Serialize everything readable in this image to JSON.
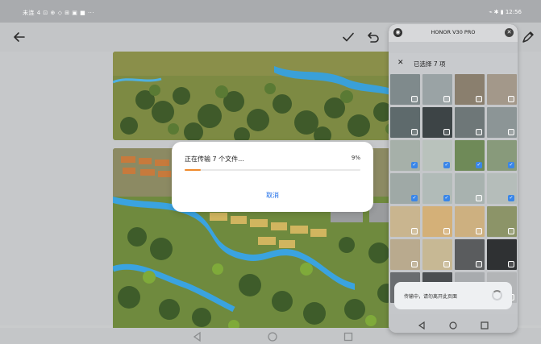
{
  "status_bar": {
    "left_text": "未连 4 ⊡ ⊕ ◇ ⊞ ▣ ■ ···",
    "right_text": "⌁ ✱ ▮ 12:56"
  },
  "toolbar": {
    "back_icon": "back-arrow-icon",
    "confirm_icon": "check-icon",
    "undo_icon": "undo-icon",
    "pen_icon": "pen-icon"
  },
  "dialog": {
    "title": "正在传输 7 个文件...",
    "percent_label": "9%",
    "progress": 0.09,
    "cancel_label": "取消",
    "accent": "#f08a2b",
    "link_color": "#1e6ee8"
  },
  "phone": {
    "title": "HONOR V30 PRO",
    "header_label": "已选择 7 项",
    "toast_text": "传输中，请勿离开此页面",
    "grid_cells": [
      {
        "color": "#7f8a8c",
        "checked": false
      },
      {
        "color": "#9aa3a5",
        "checked": false
      },
      {
        "color": "#8a7f6e",
        "checked": false
      },
      {
        "color": "#a3988a",
        "checked": false
      },
      {
        "color": "#5e6a6c",
        "checked": false
      },
      {
        "color": "#3d4446",
        "checked": false
      },
      {
        "color": "#6e7778",
        "checked": false
      },
      {
        "color": "#8c9596",
        "checked": false
      },
      {
        "color": "#a6b0a9",
        "checked": true
      },
      {
        "color": "#b9c2bc",
        "checked": true
      },
      {
        "color": "#6f8a58",
        "checked": true
      },
      {
        "color": "#889a7b",
        "checked": true
      },
      {
        "color": "#9fa9a6",
        "checked": true
      },
      {
        "color": "#b1bbb8",
        "checked": true
      },
      {
        "color": "#a8b2af",
        "checked": false
      },
      {
        "color": "#b5bdba",
        "checked": true
      },
      {
        "color": "#c9b58f",
        "checked": false
      },
      {
        "color": "#d4b078",
        "checked": false
      },
      {
        "color": "#cdb080",
        "checked": false
      },
      {
        "color": "#8c9468",
        "checked": false
      },
      {
        "color": "#b9aa8e",
        "checked": false
      },
      {
        "color": "#c7b894",
        "checked": false
      },
      {
        "color": "#5a5c5e",
        "checked": false
      },
      {
        "color": "#2f3133",
        "checked": false
      },
      {
        "color": "#6a6d70",
        "checked": false
      },
      {
        "color": "#4b4e51",
        "checked": false
      },
      {
        "color": "#a8abae",
        "checked": false
      },
      {
        "color": "#b3b5b7",
        "checked": false
      }
    ]
  }
}
